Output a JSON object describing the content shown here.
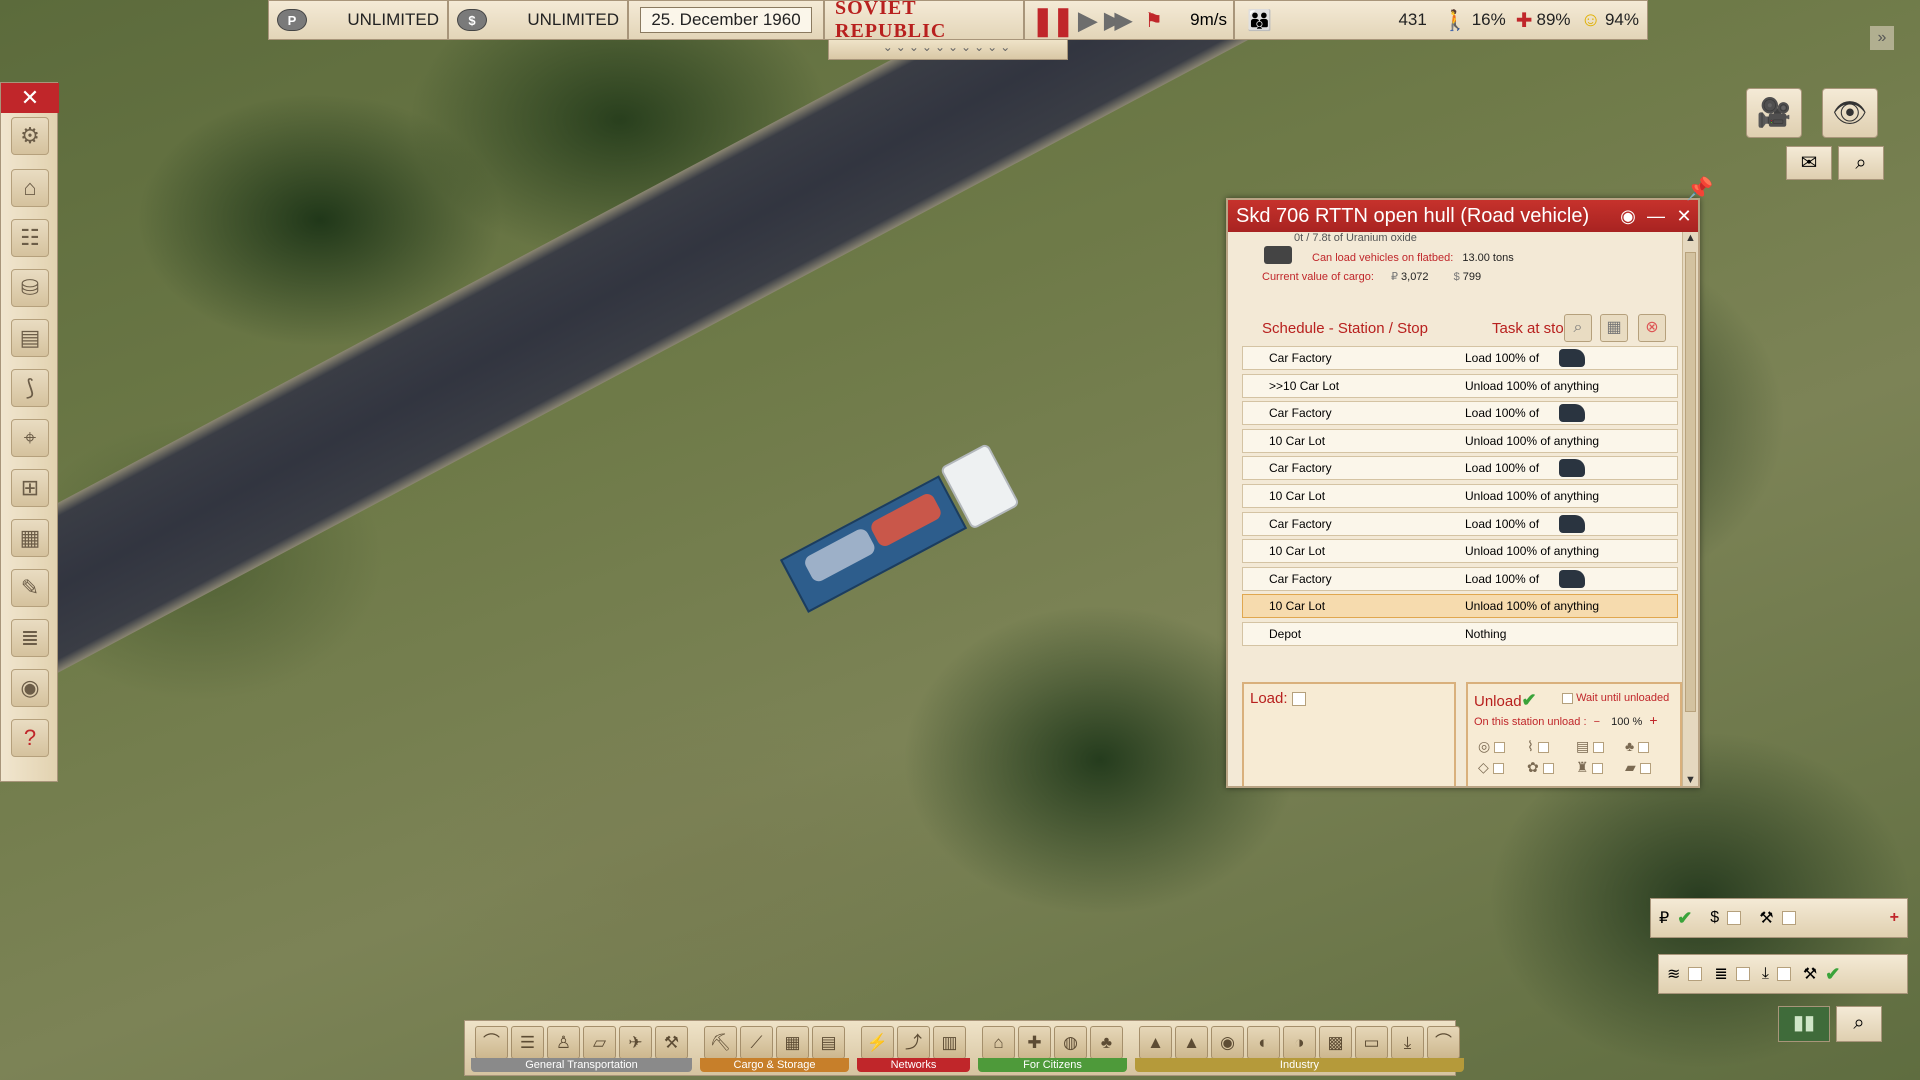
{
  "topbar": {
    "money_rubles": "UNLIMITED",
    "money_dollars": "UNLIMITED",
    "rubles_icon": "P",
    "dollars_icon": "$",
    "date": "25. December 1960",
    "logo": "SOVIET REPUBLIC",
    "wind_speed": "9m/s",
    "population": "431",
    "stat_a": "16%",
    "health": "89%",
    "happiness": "94%",
    "dropdown_marks": "⌄⌄⌄⌄⌄⌄⌄⌄⌄⌄"
  },
  "vehicle_window": {
    "title": "Skd 706 RTTN open hull (Road vehicle)",
    "cargo_line_top": "0t / 7.8t of Uranium oxide",
    "flatbed_label": "Can load vehicles on flatbed:",
    "flatbed_value": "13.00 tons",
    "cargo_value_label": "Current value of cargo:",
    "cargo_value_rub": "3,072",
    "cargo_value_usd": "799",
    "schedule_header": "Schedule - Station / Stop",
    "task_header": "Task at stop",
    "schedule": [
      {
        "station": "Car Factory",
        "task": "Load 100% of",
        "vehicle_icon": true
      },
      {
        "station": ">>10 Car Lot",
        "task": "Unload 100% of anything",
        "vehicle_icon": false
      },
      {
        "station": "Car Factory",
        "task": "Load 100% of",
        "vehicle_icon": true
      },
      {
        "station": "10 Car Lot",
        "task": "Unload 100% of anything",
        "vehicle_icon": false
      },
      {
        "station": "Car Factory",
        "task": "Load 100% of",
        "vehicle_icon": true
      },
      {
        "station": "10 Car Lot",
        "task": "Unload 100% of anything",
        "vehicle_icon": false
      },
      {
        "station": "Car Factory",
        "task": "Load 100% of",
        "vehicle_icon": true
      },
      {
        "station": "10 Car Lot",
        "task": "Unload 100% of anything",
        "vehicle_icon": false
      },
      {
        "station": "Car Factory",
        "task": "Load 100% of",
        "vehicle_icon": true
      },
      {
        "station": "10 Car Lot",
        "task": "Unload 100% of anything",
        "vehicle_icon": false,
        "selected": true
      },
      {
        "station": "Depot",
        "task": "Nothing",
        "vehicle_icon": false
      }
    ],
    "load_label": "Load:",
    "unload_label": "Unload",
    "wait_label": "Wait until unloaded",
    "station_unload_label": "On this station unload :",
    "unload_percent": "100 %"
  },
  "bottom_toolbar": {
    "groups": [
      {
        "label": "General Transportation",
        "color": "#8a8a8a"
      },
      {
        "label": "Cargo & Storage",
        "color": "#c77f2a"
      },
      {
        "label": "Networks",
        "color": "#c0262a"
      },
      {
        "label": "For Citizens",
        "color": "#4e9a3a"
      },
      {
        "label": "Industry",
        "color": "#b59a3a"
      }
    ]
  },
  "colors": {
    "accent_red": "#c0262a",
    "panel_bg": "#f3e9d6"
  }
}
